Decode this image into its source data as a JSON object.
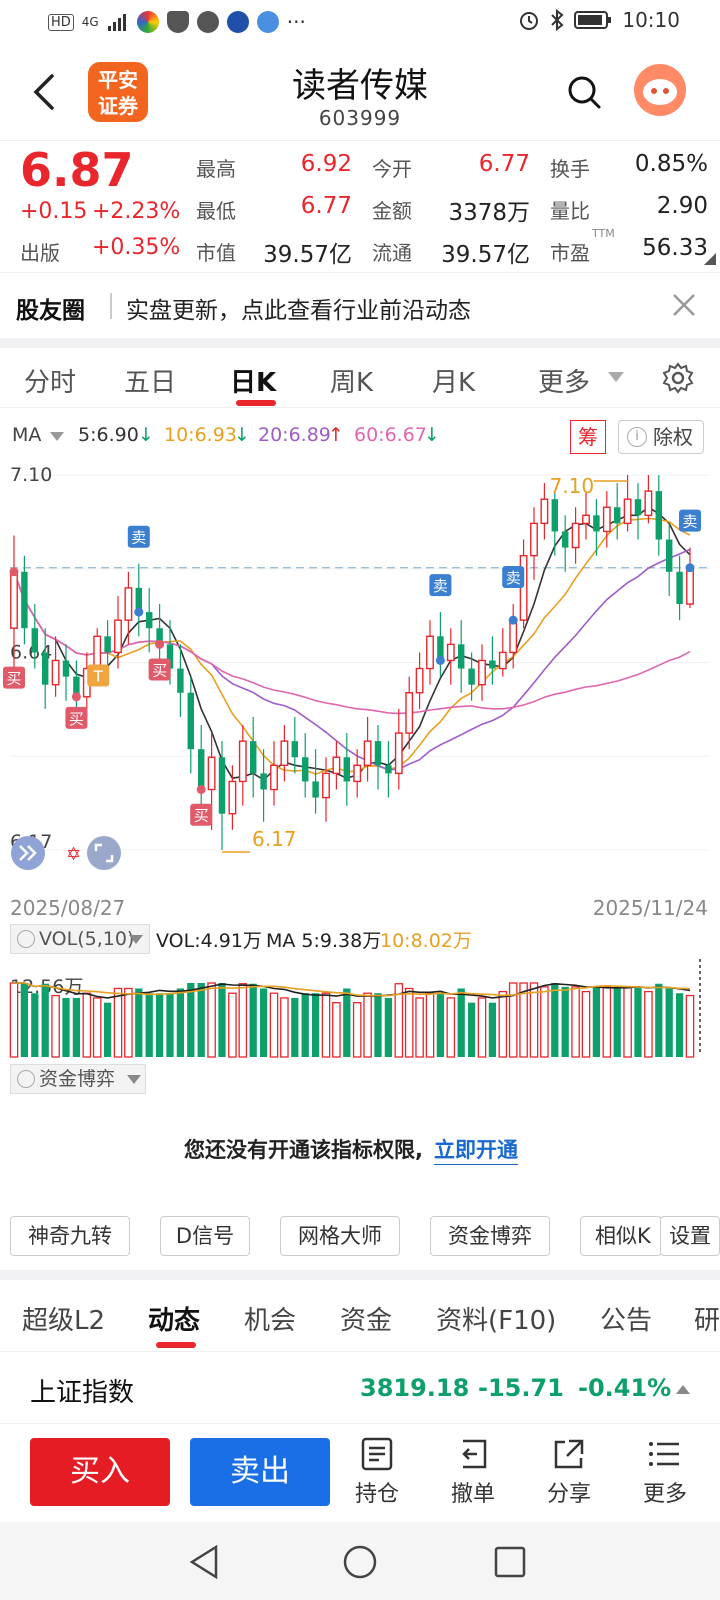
{
  "status_bar": {
    "time": "10:10",
    "network": "4G",
    "more_dots": "···"
  },
  "header": {
    "brand_line1": "平安",
    "brand_line2": "证券",
    "stock_name": "读者传媒",
    "stock_code": "603999"
  },
  "quote": {
    "price": "6.87",
    "change": "+0.15",
    "change_pct": "+2.23%",
    "sector_label": "出版",
    "sector_pct": "+0.35%",
    "fields": [
      {
        "label": "最高",
        "value": "6.92"
      },
      {
        "label": "今开",
        "value": "6.77"
      },
      {
        "label": "换手",
        "value": "0.85%"
      },
      {
        "label": "最低",
        "value": "6.77"
      },
      {
        "label": "金额",
        "value": "3378万"
      },
      {
        "label": "量比",
        "value": "2.90"
      },
      {
        "label": "市值",
        "value": "39.57亿"
      },
      {
        "label": "流通",
        "value": "39.57亿"
      },
      {
        "label": "市盈",
        "value": "56.33"
      }
    ],
    "ttm_label": "TTM"
  },
  "news": {
    "title": "股友圈",
    "text": "实盘更新，点此查看行业前沿动态"
  },
  "chart_tabs": [
    "分时",
    "五日",
    "日K",
    "周K",
    "月K",
    "更多"
  ],
  "ma_legend": {
    "label": "MA",
    "ma5": "5:6.90",
    "ma10": "10:6.93",
    "ma20": "20:6.89",
    "ma60": "60:6.67",
    "ma5_color": "#333333",
    "ma10_color": "#e8a020",
    "ma20_color": "#a05cc8",
    "ma60_color": "#e066b0"
  },
  "chart_badges": {
    "chou": "筹",
    "chuquan": "除权"
  },
  "chart_data": {
    "type": "candlestick",
    "x_start": "2025/08/27",
    "x_end": "2025/11/24",
    "y_labels": [
      "7.10",
      "6.64",
      "6.17"
    ],
    "ylim": [
      6.17,
      7.1
    ],
    "annotations": [
      "7.10",
      "6.17"
    ],
    "signals": [
      "买",
      "卖",
      "T"
    ],
    "up_color": "#e8262c",
    "down_color": "#0ea06a",
    "candles": [
      [
        6.72,
        6.86,
        6.95,
        6.6
      ],
      [
        6.86,
        6.72,
        6.9,
        6.68
      ],
      [
        6.72,
        6.66,
        6.78,
        6.62
      ],
      [
        6.66,
        6.58,
        6.72,
        6.52
      ],
      [
        6.58,
        6.64,
        6.7,
        6.55
      ],
      [
        6.64,
        6.6,
        6.68,
        6.54
      ],
      [
        6.6,
        6.55,
        6.64,
        6.5
      ],
      [
        6.55,
        6.62,
        6.66,
        6.5
      ],
      [
        6.62,
        6.7,
        6.72,
        6.58
      ],
      [
        6.7,
        6.66,
        6.74,
        6.62
      ],
      [
        6.66,
        6.74,
        6.8,
        6.62
      ],
      [
        6.74,
        6.82,
        6.86,
        6.68
      ],
      [
        6.82,
        6.76,
        6.88,
        6.7
      ],
      [
        6.76,
        6.72,
        6.82,
        6.66
      ],
      [
        6.72,
        6.68,
        6.78,
        6.62
      ],
      [
        6.68,
        6.62,
        6.74,
        6.58
      ],
      [
        6.62,
        6.56,
        6.68,
        6.5
      ],
      [
        6.56,
        6.42,
        6.6,
        6.36
      ],
      [
        6.42,
        6.32,
        6.48,
        6.26
      ],
      [
        6.32,
        6.4,
        6.46,
        6.22
      ],
      [
        6.4,
        6.26,
        6.44,
        6.17
      ],
      [
        6.26,
        6.34,
        6.38,
        6.22
      ],
      [
        6.34,
        6.44,
        6.48,
        6.28
      ],
      [
        6.44,
        6.36,
        6.5,
        6.3
      ],
      [
        6.36,
        6.32,
        6.42,
        6.24
      ],
      [
        6.32,
        6.38,
        6.44,
        6.28
      ],
      [
        6.38,
        6.44,
        6.48,
        6.34
      ],
      [
        6.44,
        6.4,
        6.5,
        6.36
      ],
      [
        6.4,
        6.34,
        6.46,
        6.3
      ],
      [
        6.34,
        6.3,
        6.42,
        6.26
      ],
      [
        6.3,
        6.36,
        6.4,
        6.24
      ],
      [
        6.36,
        6.4,
        6.44,
        6.32
      ],
      [
        6.4,
        6.34,
        6.46,
        6.28
      ],
      [
        6.34,
        6.38,
        6.42,
        6.3
      ],
      [
        6.38,
        6.44,
        6.5,
        6.34
      ],
      [
        6.44,
        6.38,
        6.48,
        6.32
      ],
      [
        6.38,
        6.36,
        6.44,
        6.3
      ],
      [
        6.36,
        6.46,
        6.52,
        6.32
      ],
      [
        6.46,
        6.56,
        6.6,
        6.42
      ],
      [
        6.56,
        6.62,
        6.66,
        6.52
      ],
      [
        6.62,
        6.7,
        6.74,
        6.58
      ],
      [
        6.7,
        6.64,
        6.76,
        6.6
      ],
      [
        6.64,
        6.68,
        6.72,
        6.58
      ],
      [
        6.68,
        6.62,
        6.74,
        6.56
      ],
      [
        6.62,
        6.58,
        6.66,
        6.54
      ],
      [
        6.58,
        6.64,
        6.68,
        6.54
      ],
      [
        6.64,
        6.62,
        6.7,
        6.58
      ],
      [
        6.62,
        6.66,
        6.72,
        6.6
      ],
      [
        6.66,
        6.74,
        6.78,
        6.62
      ],
      [
        6.74,
        6.9,
        6.94,
        6.72
      ],
      [
        6.9,
        6.98,
        7.02,
        6.84
      ],
      [
        6.98,
        7.04,
        7.08,
        6.94
      ],
      [
        7.04,
        6.96,
        7.06,
        6.9
      ],
      [
        6.96,
        6.92,
        7.0,
        6.86
      ],
      [
        6.92,
        6.98,
        7.02,
        6.88
      ],
      [
        6.98,
        7.0,
        7.06,
        6.94
      ],
      [
        7.0,
        6.96,
        7.04,
        6.9
      ],
      [
        6.96,
        7.02,
        7.06,
        6.92
      ],
      [
        7.02,
        6.98,
        7.08,
        6.94
      ],
      [
        6.98,
        7.04,
        7.1,
        6.96
      ],
      [
        7.04,
        7.0,
        7.08,
        6.94
      ],
      [
        7.0,
        7.06,
        7.1,
        6.98
      ],
      [
        7.06,
        6.94,
        7.1,
        6.9
      ],
      [
        6.94,
        6.86,
        6.98,
        6.8
      ],
      [
        6.86,
        6.78,
        6.9,
        6.74
      ],
      [
        6.78,
        6.87,
        6.92,
        6.77
      ]
    ]
  },
  "volume": {
    "box_label": "VOL(5,10)",
    "vol_text": "VOL:4.91万",
    "ma5_text": "MA 5:9.38万",
    "ma10_text": "10:8.02万",
    "max_label": "12.56万"
  },
  "indicator": {
    "box_label": "资金博弈",
    "perm_text": "您还没有开通该指标权限,",
    "perm_link": "立即开通"
  },
  "tools": [
    "神奇九转",
    "D信号",
    "网格大师",
    "资金博弈",
    "相似K",
    "设置"
  ],
  "info_tabs": [
    "超级L2",
    "动态",
    "机会",
    "资金",
    "资料(F10)",
    "公告",
    "研"
  ],
  "index_row": {
    "name": "上证指数",
    "value": "3819.18",
    "change": "-15.71",
    "pct": "-0.41%"
  },
  "actions": {
    "buy": "买入",
    "sell": "卖出",
    "items": [
      "持仓",
      "撤单",
      "分享",
      "更多"
    ]
  }
}
